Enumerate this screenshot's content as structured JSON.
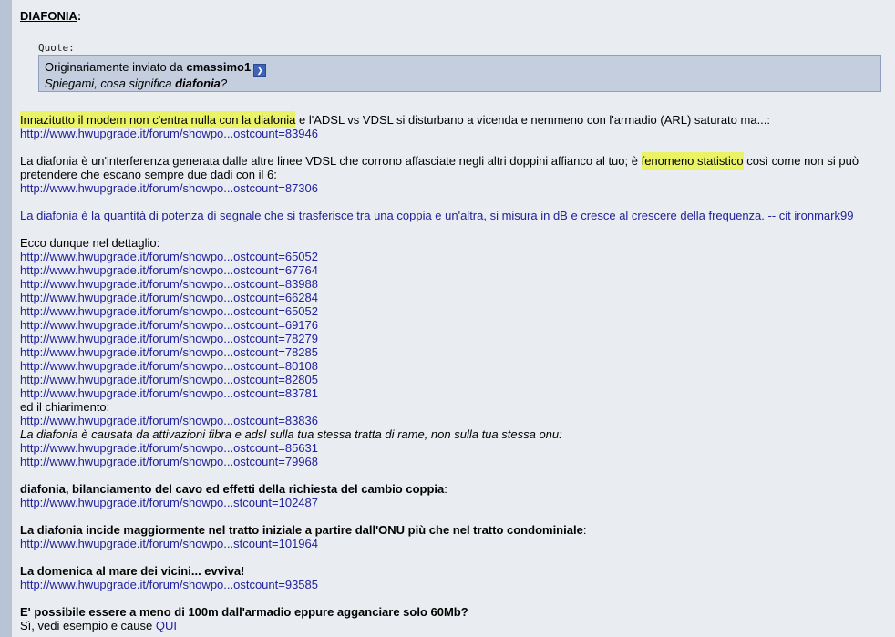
{
  "post": {
    "title": "DIAFONIA",
    "title_colon": ":",
    "quote": {
      "label": "Quote:",
      "intro": "Originariamente inviato da ",
      "author": "cmassimo1",
      "view_icon": "arrow-right-icon",
      "line2_pre": "Spiegami, cosa significa ",
      "line2_bold": "diafonia",
      "line2_post": "?"
    },
    "p1": {
      "highlight": "Innazitutto il modem non c'entra nulla con la diafonia",
      "rest": " e l'ADSL vs VDSL si disturbano a vicenda e nemmeno con l'armadio (ARL) saturato ma...:",
      "link": "http://www.hwupgrade.it/forum/showpo...ostcount=83946"
    },
    "p2": {
      "pre": "La diafonia è un'interferenza generata dalle altre linee VDSL che corrono affasciate negli altri doppini affianco al tuo; è ",
      "highlight": "fenomeno statistico",
      "post": " così come non si può",
      "line2": "pretendere che escano sempre due dadi con il 6:",
      "link": "http://www.hwupgrade.it/forum/showpo...ostcount=87306"
    },
    "p3": {
      "text": "La diafonia è la quantità di potenza di segnale che si trasferisce tra una coppia e un'altra, si misura in dB e cresce al crescere della frequenza.",
      "cite": " -- cit ironmark99"
    },
    "details": {
      "heading": "Ecco dunque nel dettaglio:",
      "links": [
        "http://www.hwupgrade.it/forum/showpo...ostcount=65052",
        "http://www.hwupgrade.it/forum/showpo...ostcount=67764",
        "http://www.hwupgrade.it/forum/showpo...ostcount=83988",
        "http://www.hwupgrade.it/forum/showpo...ostcount=66284",
        "http://www.hwupgrade.it/forum/showpo...ostcount=65052",
        "http://www.hwupgrade.it/forum/showpo...ostcount=69176",
        "http://www.hwupgrade.it/forum/showpo...ostcount=78279",
        "http://www.hwupgrade.it/forum/showpo...ostcount=78285",
        "http://www.hwupgrade.it/forum/showpo...ostcount=80108",
        "http://www.hwupgrade.it/forum/showpo...ostcount=82805",
        "http://www.hwupgrade.it/forum/showpo...ostcount=83781"
      ],
      "chiarimento_label": "ed il chiarimento:",
      "chiarimento_link": "http://www.hwupgrade.it/forum/showpo...ostcount=83836",
      "italic_note": "La diafonia è causata da attivazioni fibra e adsl sulla tua stessa tratta di rame, non sulla tua stessa onu:",
      "note_links": [
        "http://www.hwupgrade.it/forum/showpo...ostcount=85631",
        "http://www.hwupgrade.it/forum/showpo...ostcount=79968"
      ]
    },
    "sections": [
      {
        "heading": "diafonia, bilanciamento del cavo ed effetti della richiesta del cambio coppia",
        "suffix": ":",
        "link": "http://www.hwupgrade.it/forum/showpo...stcount=102487"
      },
      {
        "heading": "La diafonia incide maggiormente nel tratto iniziale a partire dall'ONU più che nel tratto condominiale",
        "suffix": ":",
        "link": "http://www.hwupgrade.it/forum/showpo...stcount=101964"
      },
      {
        "heading": "La domenica al mare dei vicini... evviva!",
        "suffix": "",
        "link": "http://www.hwupgrade.it/forum/showpo...ostcount=93585"
      }
    ],
    "last": {
      "heading": "E' possibile essere a meno di 100m dall'armadio eppure agganciare solo 60Mb?",
      "answer_pre": "Sì, vedi esempio e cause ",
      "answer_link": "QUI"
    }
  },
  "colors": {
    "background": "#e9ecf0",
    "link": "#22229c",
    "highlight": "#eaf266",
    "quote_bg": "#c5cedf"
  }
}
